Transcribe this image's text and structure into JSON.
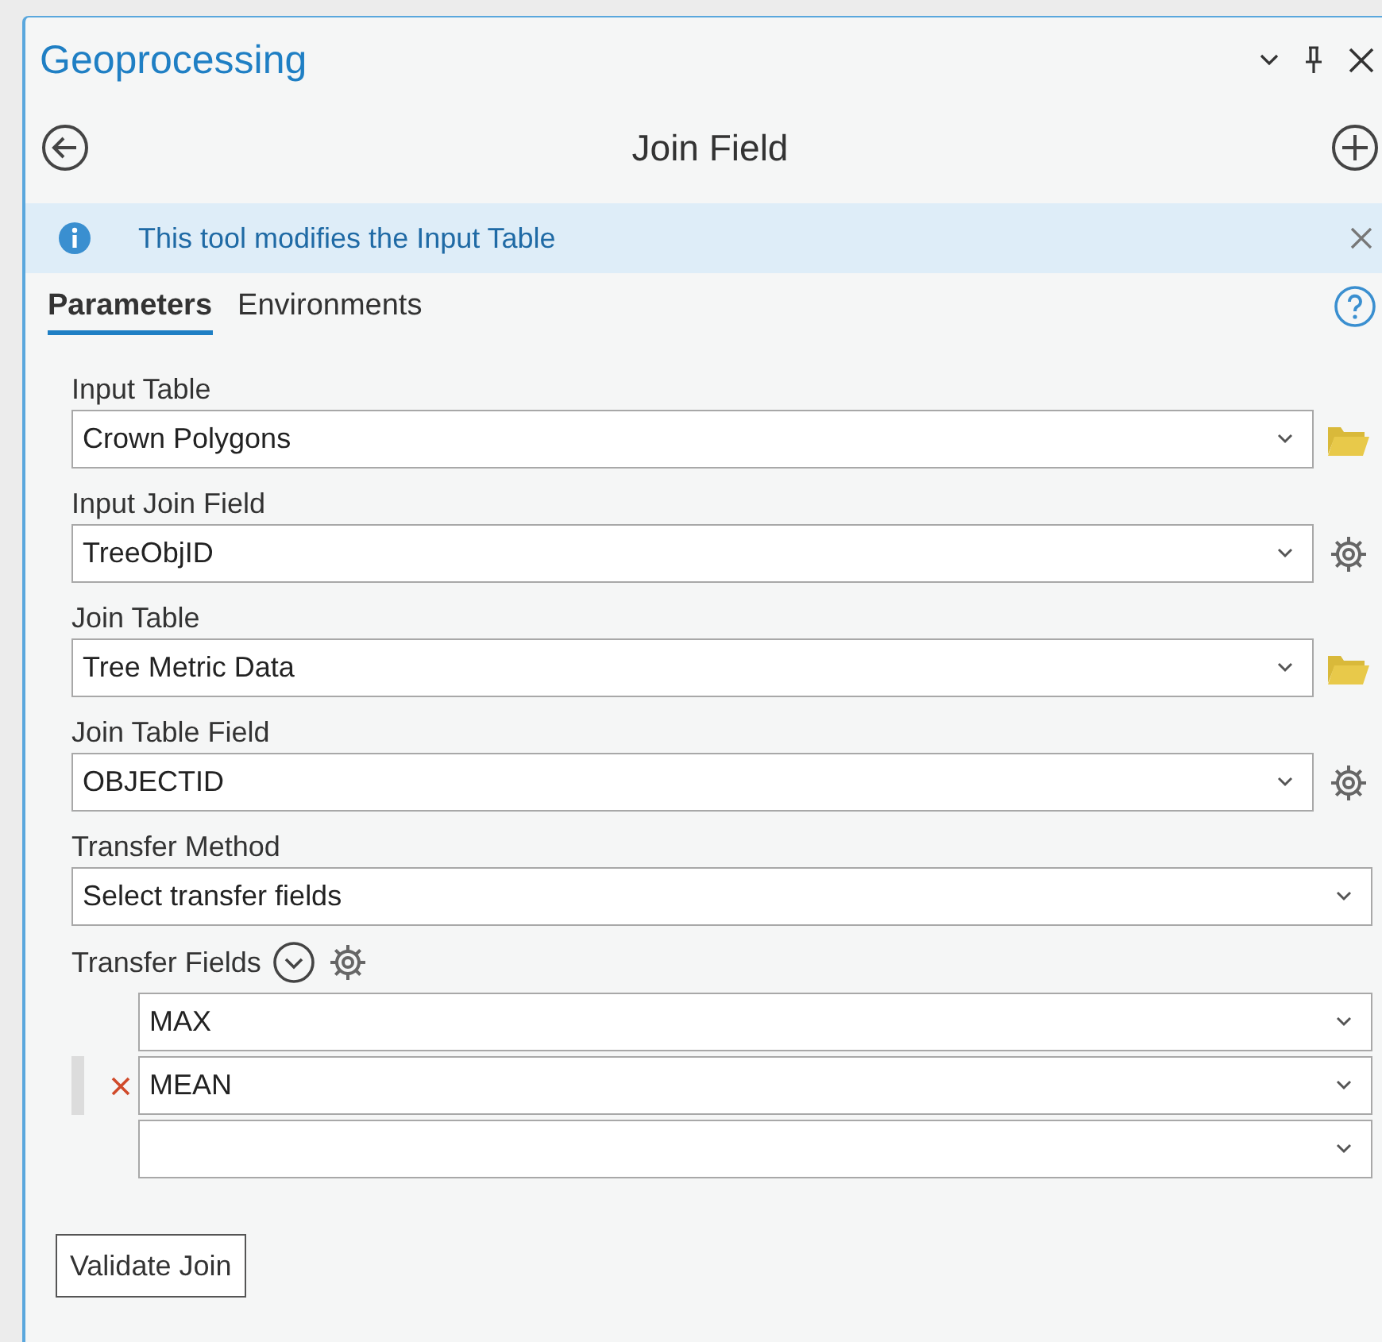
{
  "pane": {
    "title": "Geoprocessing"
  },
  "tool": {
    "title": "Join Field"
  },
  "info_bar": {
    "message": "This tool modifies the Input Table"
  },
  "tabs": [
    {
      "label": "Parameters",
      "selected": true
    },
    {
      "label": "Environments",
      "selected": false
    }
  ],
  "parameters": [
    {
      "kind": "table",
      "label": "Input Table",
      "value": "Crown Polygons"
    },
    {
      "kind": "field",
      "label": "Input Join Field",
      "value": "TreeObjID"
    },
    {
      "kind": "table",
      "label": "Join Table",
      "value": "Tree Metric Data"
    },
    {
      "kind": "field",
      "label": "Join Table Field",
      "value": "OBJECTID"
    },
    {
      "kind": "choice",
      "label": "Transfer Method",
      "value": "Select transfer fields"
    }
  ],
  "transfer_fields": {
    "label": "Transfer Fields",
    "rows": [
      {
        "value": "MAX",
        "hovered": false
      },
      {
        "value": "MEAN",
        "hovered": true
      },
      {
        "value": "",
        "hovered": false
      }
    ]
  },
  "buttons": [
    {
      "label": "Validate Join"
    }
  ]
}
